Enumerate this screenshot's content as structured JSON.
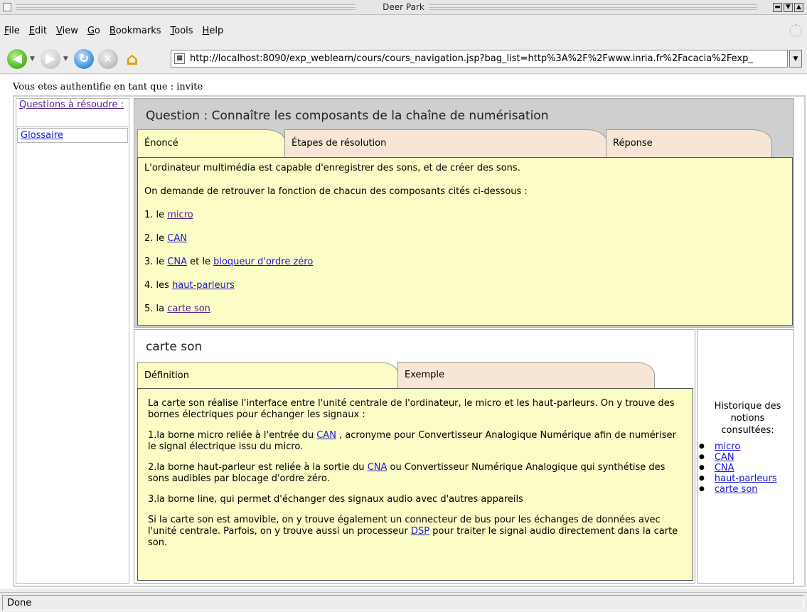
{
  "window": {
    "title": "Deer Park"
  },
  "menu": {
    "items": [
      {
        "label": "File",
        "key": "F"
      },
      {
        "label": "Edit",
        "key": "E"
      },
      {
        "label": "View",
        "key": "V"
      },
      {
        "label": "Go",
        "key": "G"
      },
      {
        "label": "Bookmarks",
        "key": "B"
      },
      {
        "label": "Tools",
        "key": "T"
      },
      {
        "label": "Help",
        "key": "H"
      }
    ]
  },
  "toolbar": {
    "url": "http://localhost:8090/exp_weblearn/cours/cours_navigation.jsp?bag_list=http%3A%2F%2Fwww.inria.fr%2Facacia%2Fexp_"
  },
  "page": {
    "auth_text": "Vous etes authentifie en tant que : invite",
    "left_nav": {
      "questions_link": "Questions à résoudre :",
      "glossary_link": "Glossaire"
    },
    "question": {
      "title": "Question : Connaître les composants de la chaîne de numérisation",
      "tabs": {
        "t1": "Énoncé",
        "t2": "Étapes de résolution",
        "t3": "Réponse"
      },
      "intro1": "L'ordinateur multimédia est capable d'enregistrer des sons, et de créer des sons.",
      "intro2": "On demande de retrouver la fonction de chacun des composants cités ci-dessous :",
      "items": {
        "i1_prefix": "1. le ",
        "i1_link": "micro",
        "i2_prefix": "2. le ",
        "i2_link": "CAN",
        "i3_prefix": "3. le ",
        "i3_link1": "CNA",
        "i3_mid": " et le ",
        "i3_link2": "bloqueur d'ordre zéro",
        "i4_prefix": "4. les ",
        "i4_link": "haut-parleurs",
        "i5_prefix": "5. la ",
        "i5_link": "carte son"
      }
    },
    "notion": {
      "title": "carte son",
      "tabs": {
        "t1": "Définition",
        "t2": "Exemple"
      },
      "p1": "La carte son réalise l'interface entre l'unité centrale de l'ordinateur, le micro et les haut-parleurs. On y trouve des bornes électriques pour échanger les signaux :",
      "p2_a": "1.la borne micro reliée à l'entrée du ",
      "p2_link": "CAN",
      "p2_b": " , acronyme pour Convertisseur Analogique Numérique afin de numériser le signal électrique issu du micro.",
      "p3_a": "2.la borne haut-parleur est reliée à la sortie du ",
      "p3_link": "CNA",
      "p3_b": " ou Convertisseur Numérique Analogique qui synthétise des sons audibles par blocage d'ordre zéro.",
      "p4": "3.la borne line, qui permet d'échanger des signaux audio avec d'autres appareils",
      "p5_a": "Si la carte son est amovible, on y trouve également un connecteur de bus pour les échanges de données avec l'unité centrale. Parfois, on y trouve aussi un processeur ",
      "p5_link": "DSP",
      "p5_b": " pour traiter le signal audio directement dans la carte son."
    },
    "history": {
      "title": "Historique des notions consultées:",
      "items": [
        "micro",
        "CAN",
        "CNA",
        "haut-parleurs",
        "carte son"
      ]
    }
  },
  "status": {
    "text": "Done"
  },
  "colors": {
    "tab_active": "#fcfcc6",
    "tab_inactive": "#f7e6d6",
    "panel_grey": "#cfcfcf",
    "link": "#1a1ad0",
    "visited": "#55218b"
  }
}
